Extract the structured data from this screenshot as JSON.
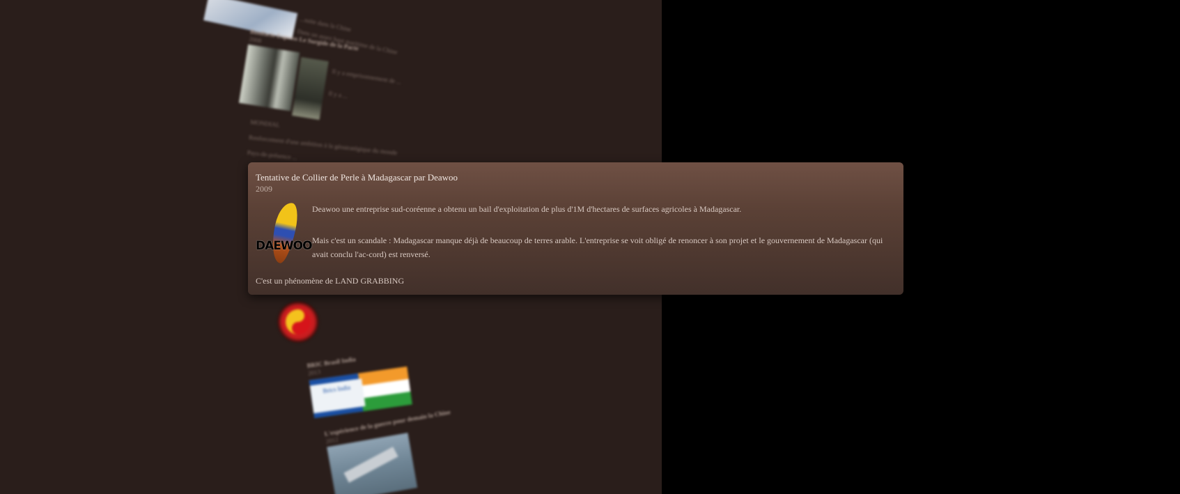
{
  "popup": {
    "title": "Tentative de Collier de Perle à Madagascar par Deawoo",
    "year": "2009",
    "logo_text": "DAEWOO",
    "paragraph_1": "Deawoo une entreprise sud-coréenne a obtenu un bail d'exploitation de plus d'1M d'hectares de surfaces agricoles à Madagascar.",
    "paragraph_2": "Mais c'est un scandale : Madagascar manque déjà de beaucoup de terres arable. L'entreprise se voit obligé de renoncer à son projet et le gouvernement de Madagascar (qui avait conclu l'ac-cord) est renversé.",
    "footer": "C'est un phénomène de LAND GRABBING"
  },
  "background": {
    "block1": {
      "lines": [
        "Dans la tr...",
        "...suite dans la Chine"
      ],
      "caption": "Dans un assez haut maritime de la Chine"
    },
    "block2": {
      "title": "Bonifacio Express Le Surgide de la Pacte",
      "year": "2008",
      "lines": [
        "Il y a emprisonnement de ...",
        "Il y a ..."
      ]
    },
    "block3": {
      "lines": [
        "MONDIAL",
        "Renforcement d'une ambition à la géostratégique du monde",
        "Pays-de-présence ..."
      ]
    },
    "block4": {
      "title": "BRIC Brasil India",
      "year": "2013",
      "banner": "Brics India"
    },
    "block5": {
      "title": "L'expérience de la guerre pour demain la Chine",
      "year": "2012"
    }
  }
}
